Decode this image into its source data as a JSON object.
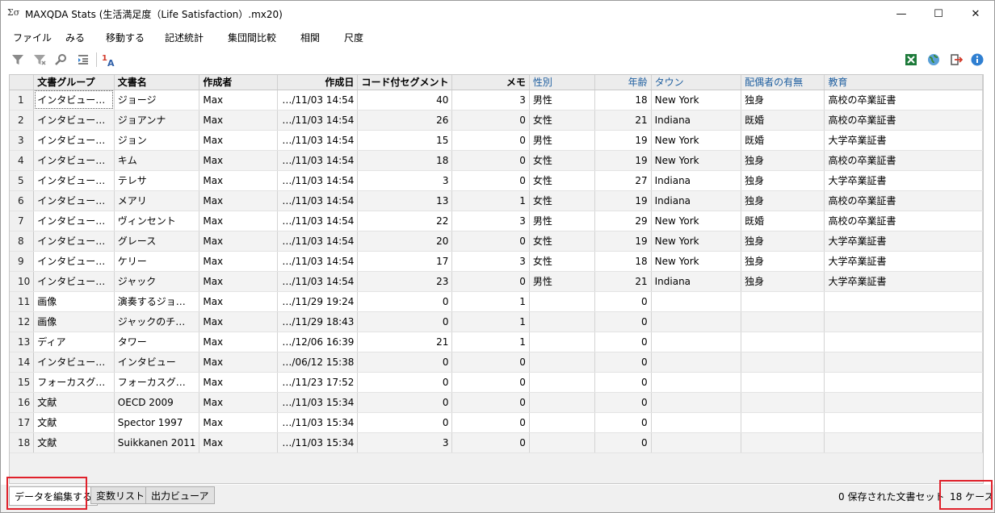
{
  "window": {
    "title": "MAXQDA Stats (生活満足度（Life Satisfaction）.mx20)",
    "app_icon_glyph": "Σσ",
    "minimize_glyph": "—",
    "maximize_glyph": "☐",
    "close_glyph": "✕"
  },
  "menu": [
    "ファイル",
    "みる",
    "移動する",
    "記述統計",
    "集団間比較",
    "相関",
    "尺度"
  ],
  "toolbar": {
    "left_icons": [
      "filter-icon",
      "filter-remove-icon",
      "search-icon",
      "indent-list-icon",
      "sort-label-icon"
    ],
    "right_icons": [
      "excel-export-icon",
      "globe-icon",
      "exit-icon",
      "info-icon"
    ],
    "colors": {
      "excel": "#1d7a3a",
      "globe": "#3a8a3a",
      "exit": "#d23b2b",
      "info": "#2f7fd1",
      "grey": "#8a8a8a"
    }
  },
  "table": {
    "columns": [
      "文書グループ",
      "文書名",
      "作成者",
      "作成日",
      "コード付セグメント",
      "メモ",
      "性別",
      "年齢",
      "タウン",
      "配偶者の有無",
      "教育"
    ],
    "rows": [
      [
        "インタビュー…",
        "ジョージ",
        "Max",
        "…/11/03 14:54",
        "40",
        "3",
        "男性",
        "18",
        "New York",
        "独身",
        "高校の卒業証書"
      ],
      [
        "インタビュー…",
        "ジョアンナ",
        "Max",
        "…/11/03 14:54",
        "26",
        "0",
        "女性",
        "21",
        "Indiana",
        "既婚",
        "高校の卒業証書"
      ],
      [
        "インタビュー…",
        "ジョン",
        "Max",
        "…/11/03 14:54",
        "15",
        "0",
        "男性",
        "19",
        "New York",
        "既婚",
        "大学卒業証書"
      ],
      [
        "インタビュー…",
        "キム",
        "Max",
        "…/11/03 14:54",
        "18",
        "0",
        "女性",
        "19",
        "New York",
        "独身",
        "高校の卒業証書"
      ],
      [
        "インタビュー…",
        "テレサ",
        "Max",
        "…/11/03 14:54",
        "3",
        "0",
        "女性",
        "27",
        "Indiana",
        "独身",
        "大学卒業証書"
      ],
      [
        "インタビュー…",
        "メアリ",
        "Max",
        "…/11/03 14:54",
        "13",
        "1",
        "女性",
        "19",
        "Indiana",
        "独身",
        "高校の卒業証書"
      ],
      [
        "インタビュー…",
        "ヴィンセント",
        "Max",
        "…/11/03 14:54",
        "22",
        "3",
        "男性",
        "29",
        "New York",
        "既婚",
        "高校の卒業証書"
      ],
      [
        "インタビュー…",
        "グレース",
        "Max",
        "…/11/03 14:54",
        "20",
        "0",
        "女性",
        "19",
        "New York",
        "独身",
        "大学卒業証書"
      ],
      [
        "インタビュー…",
        "ケリー",
        "Max",
        "…/11/03 14:54",
        "17",
        "3",
        "女性",
        "18",
        "New York",
        "独身",
        "大学卒業証書"
      ],
      [
        "インタビュー…",
        "ジャック",
        "Max",
        "…/11/03 14:54",
        "23",
        "0",
        "男性",
        "21",
        "Indiana",
        "独身",
        "大学卒業証書"
      ],
      [
        "画像",
        "演奏するジョ…",
        "Max",
        "…/11/29 19:24",
        "0",
        "1",
        "",
        "0",
        "",
        "",
        ""
      ],
      [
        "画像",
        "ジャックのチ…",
        "Max",
        "…/11/29 18:43",
        "0",
        "1",
        "",
        "0",
        "",
        "",
        ""
      ],
      [
        "ディア",
        "タワー",
        "Max",
        "…/12/06 16:39",
        "21",
        "1",
        "",
        "0",
        "",
        "",
        ""
      ],
      [
        "インタビュー…",
        "インタビュー",
        "Max",
        "…/06/12 15:38",
        "0",
        "0",
        "",
        "0",
        "",
        "",
        ""
      ],
      [
        "フォーカスグ…",
        "フォーカスグ…",
        "Max",
        "…/11/23 17:52",
        "0",
        "0",
        "",
        "0",
        "",
        "",
        ""
      ],
      [
        "文献",
        "OECD 2009",
        "Max",
        "…/11/03 15:34",
        "0",
        "0",
        "",
        "0",
        "",
        "",
        ""
      ],
      [
        "文献",
        "Spector 1997",
        "Max",
        "…/11/03 15:34",
        "0",
        "0",
        "",
        "0",
        "",
        "",
        ""
      ],
      [
        "文献",
        "Suikkanen 2011",
        "Max",
        "…/11/03 15:34",
        "3",
        "0",
        "",
        "0",
        "",
        "",
        ""
      ]
    ]
  },
  "statusbar": {
    "tabs": [
      "データを編集する",
      "変数リスト",
      "出力ビューア"
    ],
    "saved_sets": "0 保存された文書セット",
    "cases": "18 ケース"
  }
}
